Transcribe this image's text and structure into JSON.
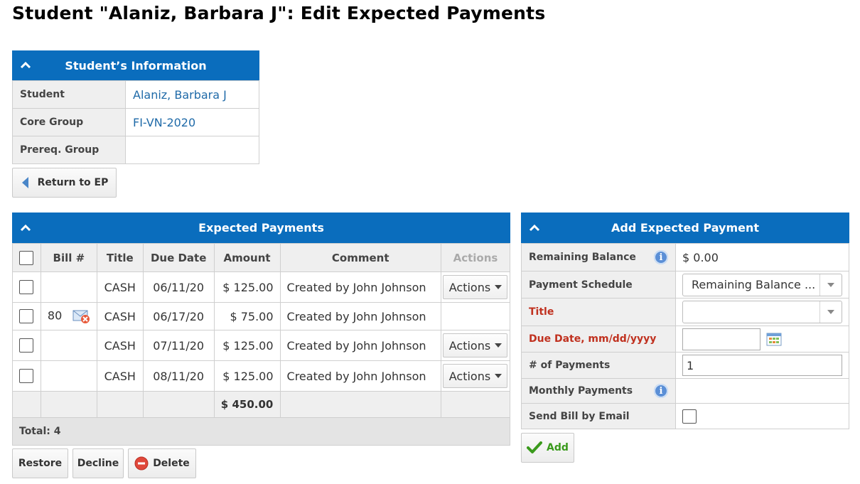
{
  "page": {
    "title": "Student \"Alaniz, Barbara J\": Edit Expected Payments"
  },
  "student_info": {
    "header": "Student’s Information",
    "rows": [
      {
        "label": "Student",
        "value": "Alaniz, Barbara J"
      },
      {
        "label": "Core Group",
        "value": "FI-VN-2020"
      },
      {
        "label": "Prereq. Group",
        "value": ""
      }
    ]
  },
  "return_button": {
    "label": "Return to EP"
  },
  "expected_payments": {
    "header": "Expected Payments",
    "columns": {
      "bill": "Bill #",
      "title": "Title",
      "due_date": "Due Date",
      "amount": "Amount",
      "comment": "Comment",
      "actions": "Actions"
    },
    "rows": [
      {
        "bill": "",
        "title": "CASH",
        "due_date": "06/11/20",
        "amount": "$ 125.00",
        "comment": "Created by John Johnson",
        "action_label": "Actions"
      },
      {
        "bill": "80",
        "title": "CASH",
        "due_date": "06/17/20",
        "amount": "$ 75.00",
        "comment": "Created by John Johnson",
        "action_label": ""
      },
      {
        "bill": "",
        "title": "CASH",
        "due_date": "07/11/20",
        "amount": "$ 125.00",
        "comment": "Created by John Johnson",
        "action_label": "Actions"
      },
      {
        "bill": "",
        "title": "CASH",
        "due_date": "08/11/20",
        "amount": "$ 125.00",
        "comment": "Created by John Johnson",
        "action_label": "Actions"
      }
    ],
    "total_amount": "$ 450.00",
    "total_label": "Total: 4"
  },
  "bottom_buttons": {
    "restore": "Restore",
    "decline": "Decline",
    "delete": "Delete"
  },
  "add_payment": {
    "header": "Add Expected Payment",
    "remaining_balance_label": "Remaining Balance",
    "remaining_balance_value": "$ 0.00",
    "payment_schedule_label": "Payment Schedule",
    "payment_schedule_value": "Remaining Balance ...",
    "title_label": "Title",
    "title_value": "",
    "due_date_label": "Due Date, mm/dd/yyyy",
    "due_date_value": "",
    "num_payments_label": "# of Payments",
    "num_payments_value": "1",
    "monthly_payments_label": "Monthly Payments",
    "send_bill_label": "Send Bill by Email",
    "add_button": "Add"
  },
  "colors": {
    "header_blue": "#0a6dbd",
    "link_blue": "#1f6aa8",
    "required_red": "#c0311f",
    "add_green": "#3a9a1c"
  }
}
